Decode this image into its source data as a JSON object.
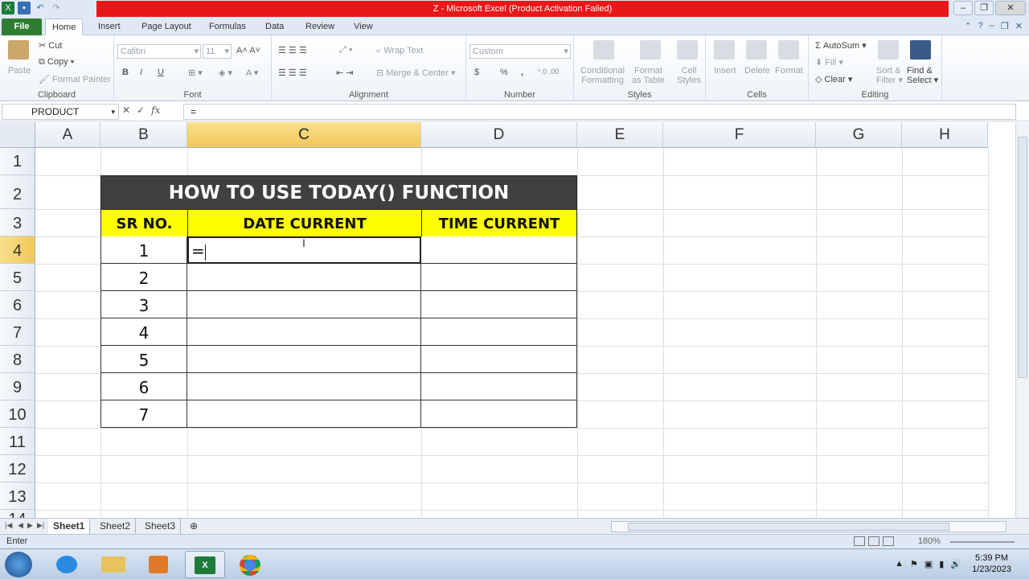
{
  "window": {
    "title": "Z  -  Microsoft Excel (Product Activation Failed)"
  },
  "ribbon_tabs": [
    "File",
    "Home",
    "Insert",
    "Page Layout",
    "Formulas",
    "Data",
    "Review",
    "View"
  ],
  "ribbon": {
    "clipboard": {
      "label": "Clipboard",
      "paste": "Paste",
      "cut": "Cut",
      "copy": "Copy",
      "format_painter": "Format Painter"
    },
    "font": {
      "label": "Font",
      "name": "Calibri",
      "size": "11",
      "bold": "B",
      "italic": "I",
      "underline": "U"
    },
    "alignment": {
      "label": "Alignment",
      "wrap_text": "Wrap Text",
      "merge_center": "Merge & Center"
    },
    "number": {
      "label": "Number",
      "format": "Custom",
      "currency": "$",
      "percent": "%",
      "comma": ","
    },
    "styles": {
      "label": "Styles",
      "conditional": [
        "Conditional",
        "Formatting"
      ],
      "format_table": [
        "Format",
        "as Table"
      ],
      "cell_styles": [
        "Cell",
        "Styles"
      ]
    },
    "cells": {
      "label": "Cells",
      "insert": "Insert",
      "delete": "Delete",
      "format": "Format"
    },
    "editing": {
      "label": "Editing",
      "autosum": "AutoSum",
      "fill": "Fill",
      "clear": "Clear",
      "sort": [
        "Sort &",
        "Filter"
      ],
      "find": [
        "Find &",
        "Select"
      ]
    }
  },
  "formula_bar": {
    "name_box": "PRODUCT",
    "fx": "fx",
    "content": "="
  },
  "grid": {
    "columns": [
      "A",
      "B",
      "C",
      "D",
      "E",
      "F",
      "G",
      "H"
    ],
    "rows": [
      "1",
      "2",
      "3",
      "4",
      "5",
      "6",
      "7",
      "8",
      "9",
      "10",
      "11",
      "12",
      "13",
      "14"
    ],
    "selected_column": "C",
    "selected_row": "4"
  },
  "sheet": {
    "title": "HOW TO USE TODAY() FUNCTION",
    "headers": [
      "SR NO.",
      "DATE CURRENT",
      "TIME CURRENT"
    ],
    "sr_numbers": [
      "1",
      "2",
      "3",
      "4",
      "5",
      "6",
      "7"
    ],
    "active_cell_value": "="
  },
  "sheet_tabs": [
    "Sheet1",
    "Sheet2",
    "Sheet3"
  ],
  "status": {
    "mode": "Enter",
    "zoom": "180%"
  },
  "taskbar": {
    "time": "5:39 PM",
    "date": "1/23/2023"
  }
}
